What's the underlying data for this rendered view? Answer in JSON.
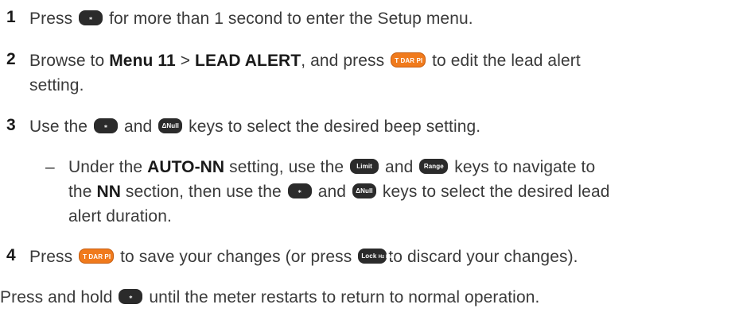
{
  "steps": [
    {
      "num": "1",
      "t1": "Press",
      "key1": "⁎",
      "t2": "for more than 1 second to enter the Setup menu."
    },
    {
      "num": "2",
      "t1": "Browse to",
      "b1": "Menu 11",
      "t2": ">",
      "b2": "LEAD ALERT",
      "t3": ", and press",
      "key1": "T DAR PI",
      "t4": "to edit the lead alert",
      "cont": "setting."
    },
    {
      "num": "3",
      "t1": "Use the",
      "key1": "⁎",
      "t2": "and",
      "key2": "ΔNull",
      "t3": "keys to select the desired beep setting."
    },
    {
      "num": "4",
      "t1": "Press",
      "key1": "T DAR PI",
      "t2": "to save your changes (or press",
      "key2": "Lock",
      "key2sub": "Hz Esc",
      "t3": "to discard your changes)."
    }
  ],
  "sub_bullet": {
    "dash": "–",
    "t1": "Under the",
    "b1": "AUTO-NN",
    "t2": "setting, use the",
    "key1": "Limit",
    "t3": "and",
    "key2": "Range",
    "t4": "keys to navigate to",
    "l2_t1": "the",
    "l2_b1": "NN",
    "l2_t2": "section, then use the",
    "l2_key1": "⁎",
    "l2_t3": "and",
    "l2_key2": "ΔNull",
    "l2_t4": "keys to select the desired lead",
    "l3": "alert duration."
  },
  "footer": {
    "t1": "Press and hold",
    "key1": "⁎",
    "t2": "until the meter restarts to return to normal operation."
  },
  "colors": {
    "text": "#3a3a3a",
    "key_dark": "#2b2b2b",
    "key_orange": "#f07a1c"
  }
}
